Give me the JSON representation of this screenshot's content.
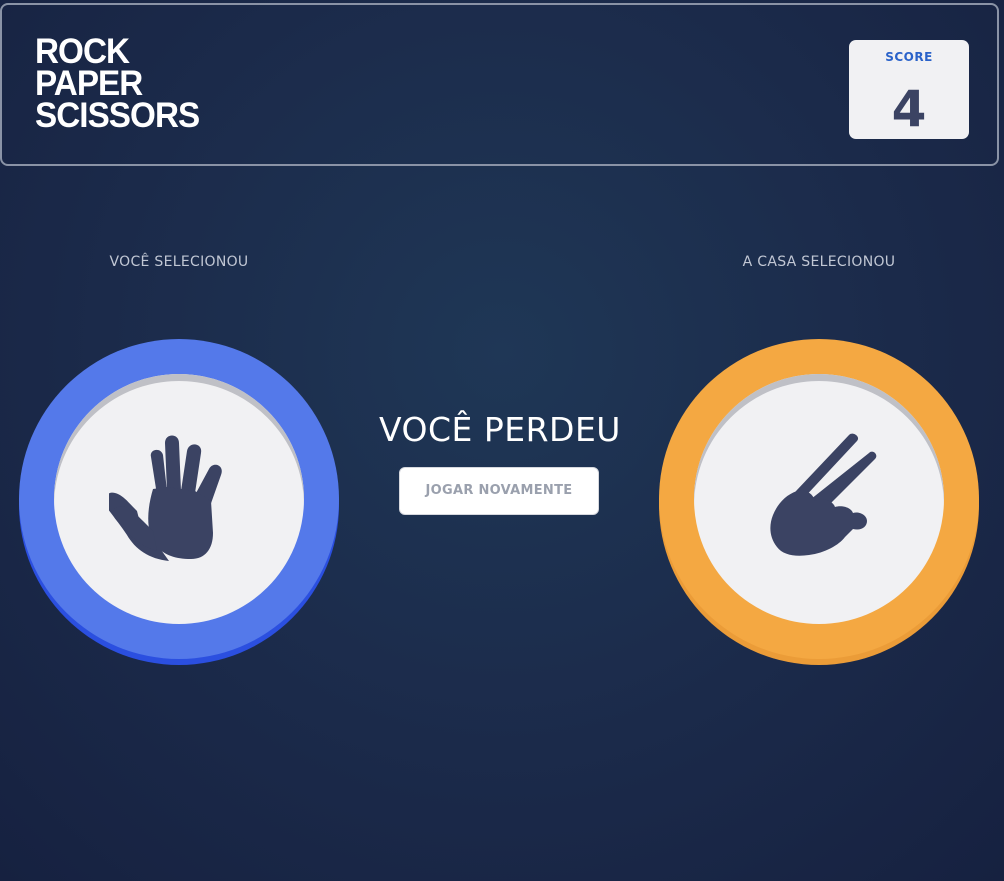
{
  "header": {
    "title_lines": [
      "ROCK",
      "PAPER",
      "SCISSORS"
    ],
    "score_label": "SCORE",
    "score_value": "4"
  },
  "game": {
    "player_label": "VOCÊ SELECIONOU",
    "house_label": "A CASA SELECIONOU",
    "player_choice": "paper",
    "house_choice": "scissors",
    "result_text": "VOCÊ PERDEU",
    "play_again_label": "JOGAR NOVAMENTE"
  },
  "colors": {
    "paper_ring": "#5479ea",
    "scissors_ring": "#f4a842",
    "icon": "#3b4363",
    "score_label": "#2a62c9"
  },
  "icons": {
    "paper": "hand-open-icon",
    "scissors": "hand-scissors-icon"
  }
}
